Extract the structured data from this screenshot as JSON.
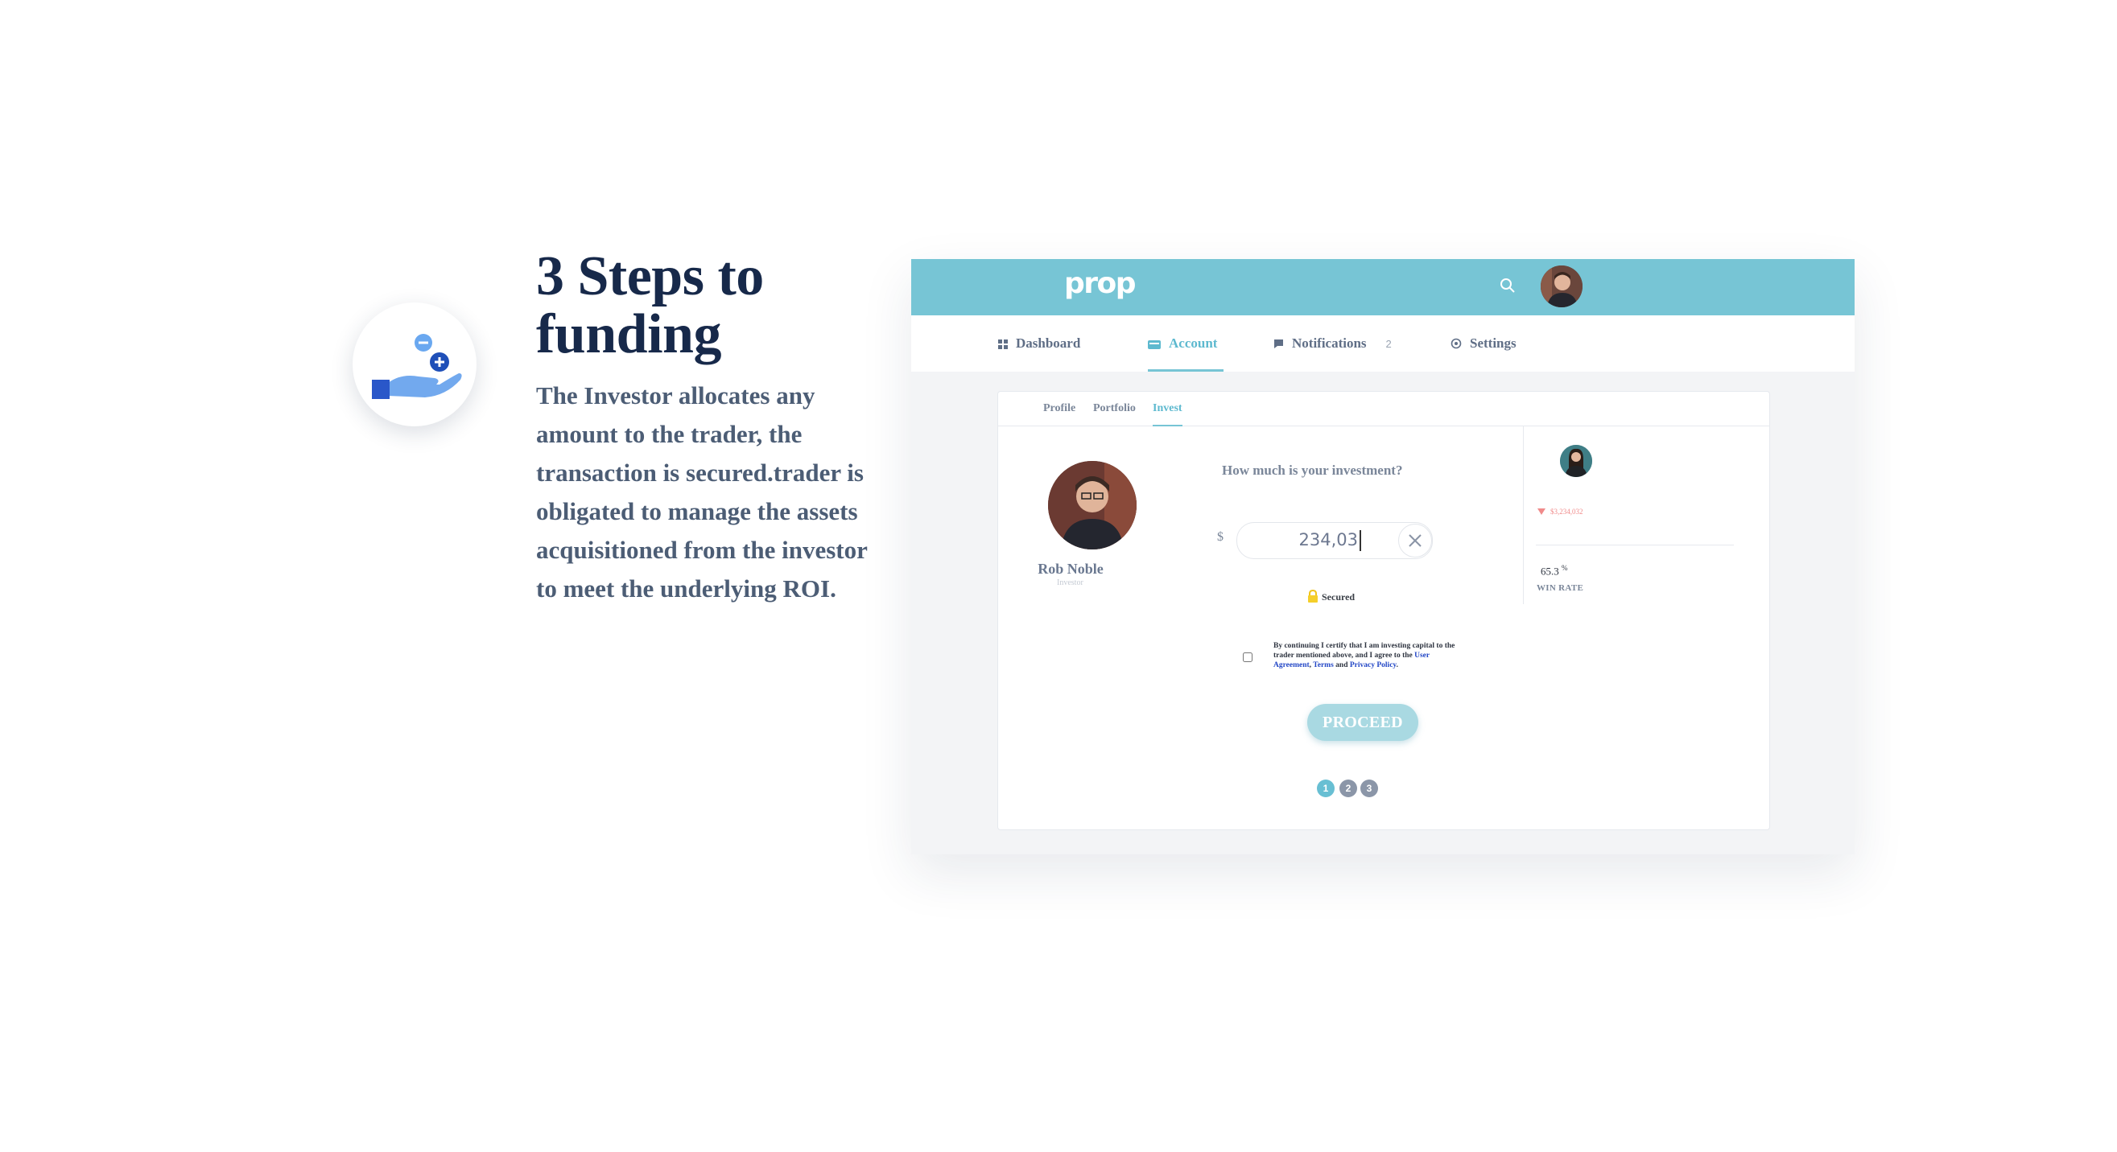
{
  "hero": {
    "title": "3 Steps to funding",
    "text": "The Investor allocates any amount to the trader, the transaction is secured.trader is obligated to manage the assets acquisitioned from the investor to meet the underlying ROI.",
    "icon": "hand-coins-icon"
  },
  "app": {
    "logo": "prop",
    "nav": {
      "dashboard": "Dashboard",
      "account": "Account",
      "notifications": "Notifications",
      "notifications_count": "2",
      "settings": "Settings",
      "active": "Account"
    },
    "subtabs": {
      "profile": "Profile",
      "portfolio": "Portfolio",
      "invest": "Invest",
      "active": "Invest"
    },
    "trader": {
      "name": "Rob Noble",
      "role": "Investor"
    },
    "invest": {
      "question": "How much is your investment?",
      "currency": "$",
      "amount": "234,03",
      "secured_label": "Secured",
      "agree_text": "By continuing I certify that I am investing capital to the trader mentioned above, and I agree to the",
      "link_user_agreement": "User Agreement",
      "sep_comma": ",",
      "link_terms": "Terms",
      "and_word": "and",
      "link_privacy": "Privacy Policy",
      "period": ".",
      "proceed_label": "PROCEED"
    },
    "steps": [
      "1",
      "2",
      "3"
    ],
    "active_step": "1",
    "side": {
      "value": "$3,234,032",
      "win_rate_value": "65.3",
      "win_rate_unit": "%",
      "win_rate_label": "WIN RATE"
    },
    "colors": {
      "topbar": "#77c5d5",
      "accent": "#5db9cf",
      "proceed": "#a9d9e2",
      "negative": "#f08b8b",
      "heading": "#17294a"
    }
  }
}
